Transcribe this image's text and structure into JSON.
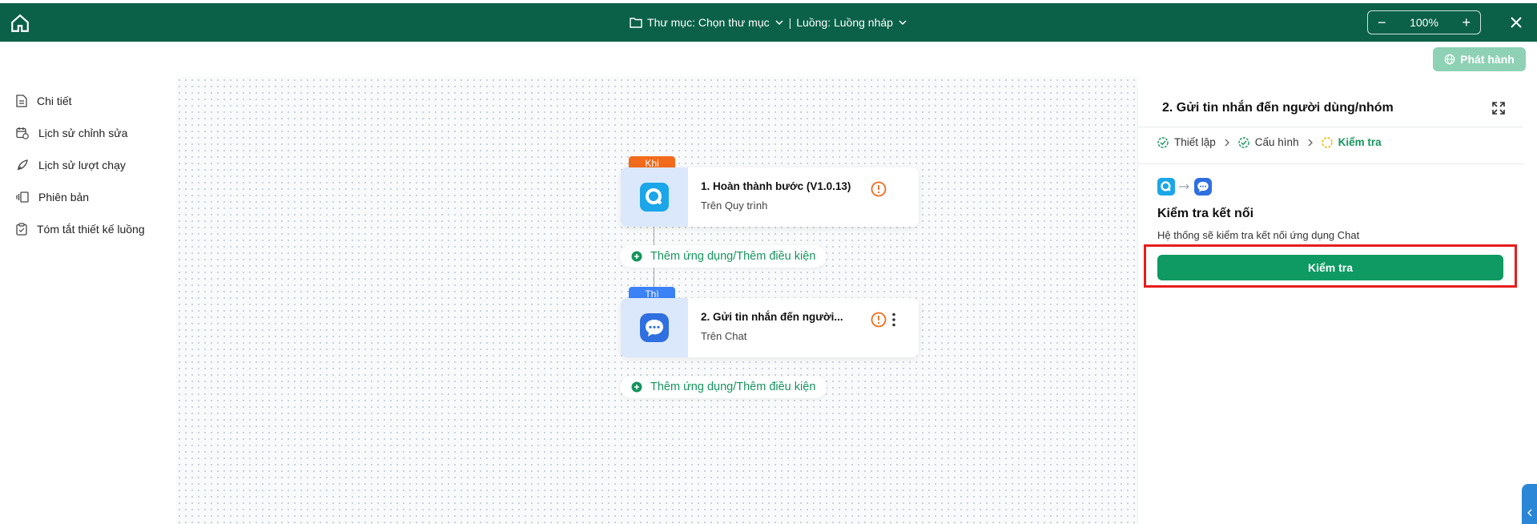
{
  "topbar": {
    "folder_label": "Thư mục: Chọn thư mục",
    "flow_label": "Luồng: Luồng nháp",
    "separator": "|",
    "zoom_value": "100%",
    "zoom_minus": "−",
    "zoom_plus": "+"
  },
  "toolbar": {
    "publish_label": "Phát hành"
  },
  "sidebar": {
    "items": [
      {
        "label": "Chi tiết",
        "icon": "document-icon"
      },
      {
        "label": "Lịch sử chỉnh sửa",
        "icon": "calendar-history-icon"
      },
      {
        "label": "Lịch sử lượt chạy",
        "icon": "rocket-icon"
      },
      {
        "label": "Phiên bản",
        "icon": "versions-icon"
      },
      {
        "label": "Tóm tắt thiết kế luồng",
        "icon": "clipboard-icon"
      }
    ]
  },
  "canvas": {
    "trigger": {
      "tag": "Khi",
      "title": "1.  Hoàn thành bước (V1.0.13)",
      "subtitle": "Trên Quy trình"
    },
    "action": {
      "tag": "Thì",
      "title": "2.  Gửi tin nhắn đến người...",
      "subtitle": "Trên Chat"
    },
    "add_label_1": "Thêm ứng dụng/Thêm điều kiện",
    "add_label_2": "Thêm ứng dụng/Thêm điều kiện"
  },
  "panel": {
    "title": "2. Gửi tin nhắn đến người dùng/nhóm",
    "steps": [
      {
        "label": "Thiết lập",
        "state": "done"
      },
      {
        "label": "Cấu hình",
        "state": "done"
      },
      {
        "label": "Kiểm tra",
        "state": "active"
      }
    ],
    "check_title": "Kiểm tra kết nối",
    "check_desc": "Hệ thống sẽ kiểm tra kết nối ứng dụng Chat",
    "test_button": "Kiểm tra"
  },
  "colors": {
    "topbar": "#0b6148",
    "accent": "#0e9a62",
    "trigger_tag": "#f26b1d",
    "action_tag": "#3b82f6",
    "warning": "#f26b1d",
    "highlight": "#e81c1c"
  }
}
